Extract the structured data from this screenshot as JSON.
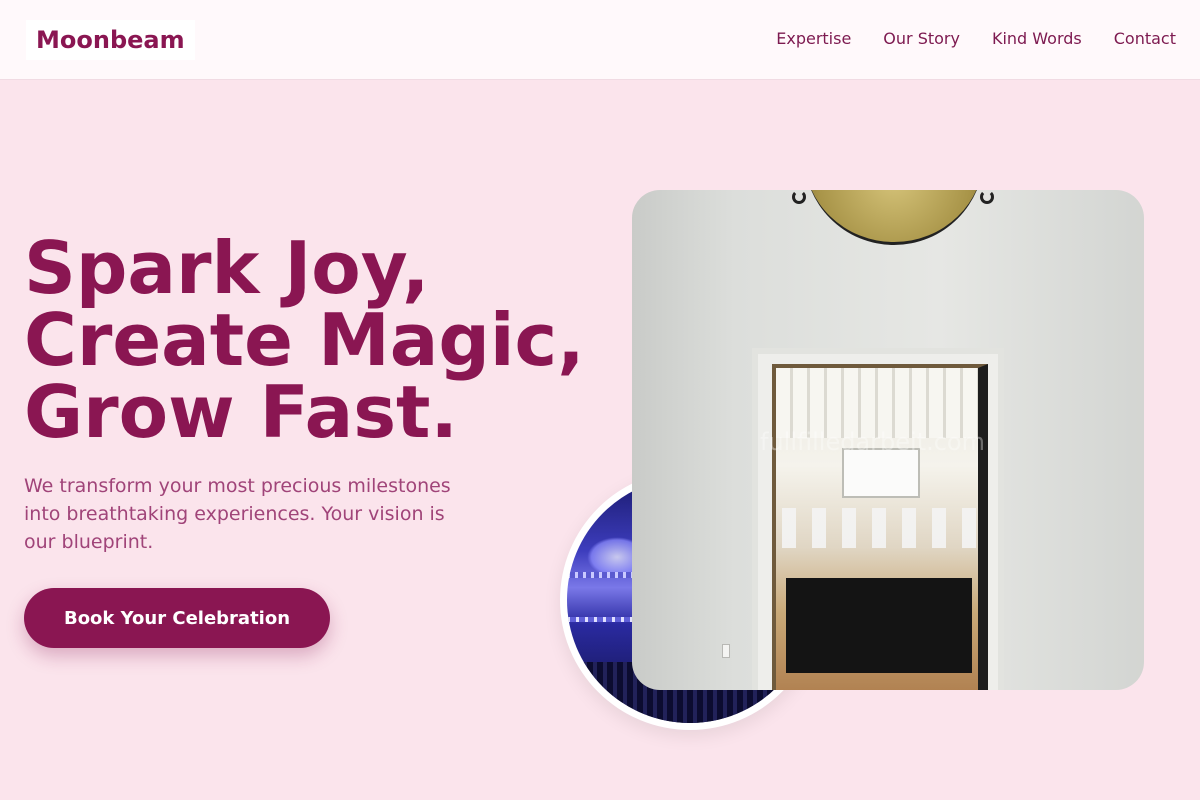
{
  "brand": {
    "logo_text": "Moonbeam",
    "primary_color": "#8a1652",
    "background_color": "#fbe4ec"
  },
  "nav": {
    "items": [
      {
        "label": "Expertise"
      },
      {
        "label": "Our Story"
      },
      {
        "label": "Kind Words"
      },
      {
        "label": "Contact"
      }
    ]
  },
  "hero": {
    "title_lines": [
      "Spark Joy,",
      "Create Magic,",
      "Grow Fast."
    ],
    "subtitle": "We transform your most precious milestones into breathtaking experiences. Your vision is our blueprint.",
    "cta_label": "Book Your Celebration"
  },
  "images": {
    "circle": "concert-stage-photo",
    "main": "event-hall-doorway-photo",
    "watermark": "fullfilledarbeit.com"
  }
}
